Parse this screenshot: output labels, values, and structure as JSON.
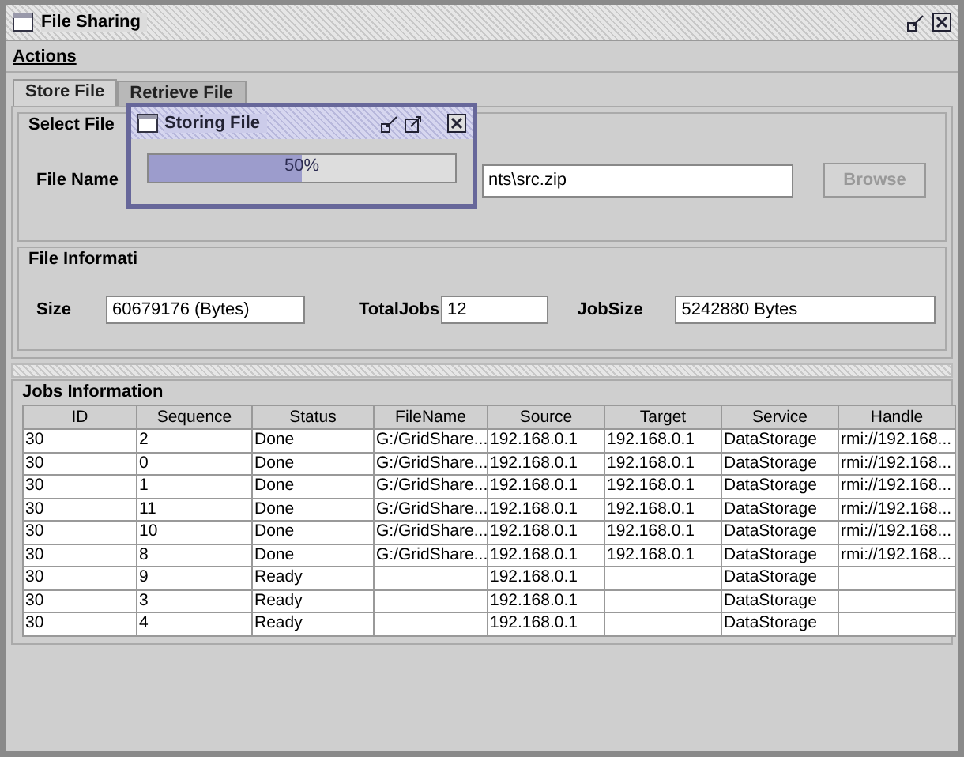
{
  "window": {
    "title": "File Sharing"
  },
  "menu": [
    "Actions"
  ],
  "tabs": [
    {
      "label": "Store File",
      "selected": true
    },
    {
      "label": "Retrieve File",
      "selected": false
    }
  ],
  "select_file": {
    "title": "Select File",
    "file_name_label": "File Name",
    "file_name_value": "nts\\src.zip",
    "browse_button": "Browse"
  },
  "file_information": {
    "title": "File Informati",
    "fields": [
      {
        "label": "Size",
        "value": "60679176 (Bytes)"
      },
      {
        "label": "TotalJobs",
        "value": "12"
      },
      {
        "label": "JobSize",
        "value": "5242880 Bytes"
      }
    ]
  },
  "jobs": {
    "title": "Jobs Information",
    "columns": [
      "ID",
      "Sequence",
      "Status",
      "FileName",
      "Source",
      "Target",
      "Service",
      "Handle"
    ],
    "rows": [
      [
        "30",
        "2",
        "Done",
        "G:/GridShare...",
        "192.168.0.1",
        "192.168.0.1",
        "DataStorage",
        "rmi://192.168..."
      ],
      [
        "30",
        "0",
        "Done",
        "G:/GridShare...",
        "192.168.0.1",
        "192.168.0.1",
        "DataStorage",
        "rmi://192.168..."
      ],
      [
        "30",
        "1",
        "Done",
        "G:/GridShare...",
        "192.168.0.1",
        "192.168.0.1",
        "DataStorage",
        "rmi://192.168..."
      ],
      [
        "30",
        "11",
        "Done",
        "G:/GridShare...",
        "192.168.0.1",
        "192.168.0.1",
        "DataStorage",
        "rmi://192.168..."
      ],
      [
        "30",
        "10",
        "Done",
        "G:/GridShare...",
        "192.168.0.1",
        "192.168.0.1",
        "DataStorage",
        "rmi://192.168..."
      ],
      [
        "30",
        "8",
        "Done",
        "G:/GridShare...",
        "192.168.0.1",
        "192.168.0.1",
        "DataStorage",
        "rmi://192.168..."
      ],
      [
        "30",
        "9",
        "Ready",
        "",
        "192.168.0.1",
        "",
        "DataStorage",
        ""
      ],
      [
        "30",
        "3",
        "Ready",
        "",
        "192.168.0.1",
        "",
        "DataStorage",
        ""
      ],
      [
        "30",
        "4",
        "Ready",
        "",
        "192.168.0.1",
        "",
        "DataStorage",
        ""
      ]
    ]
  },
  "dialog": {
    "title": "Storing File",
    "progress": {
      "level": 0.5,
      "reading": "50%"
    }
  }
}
